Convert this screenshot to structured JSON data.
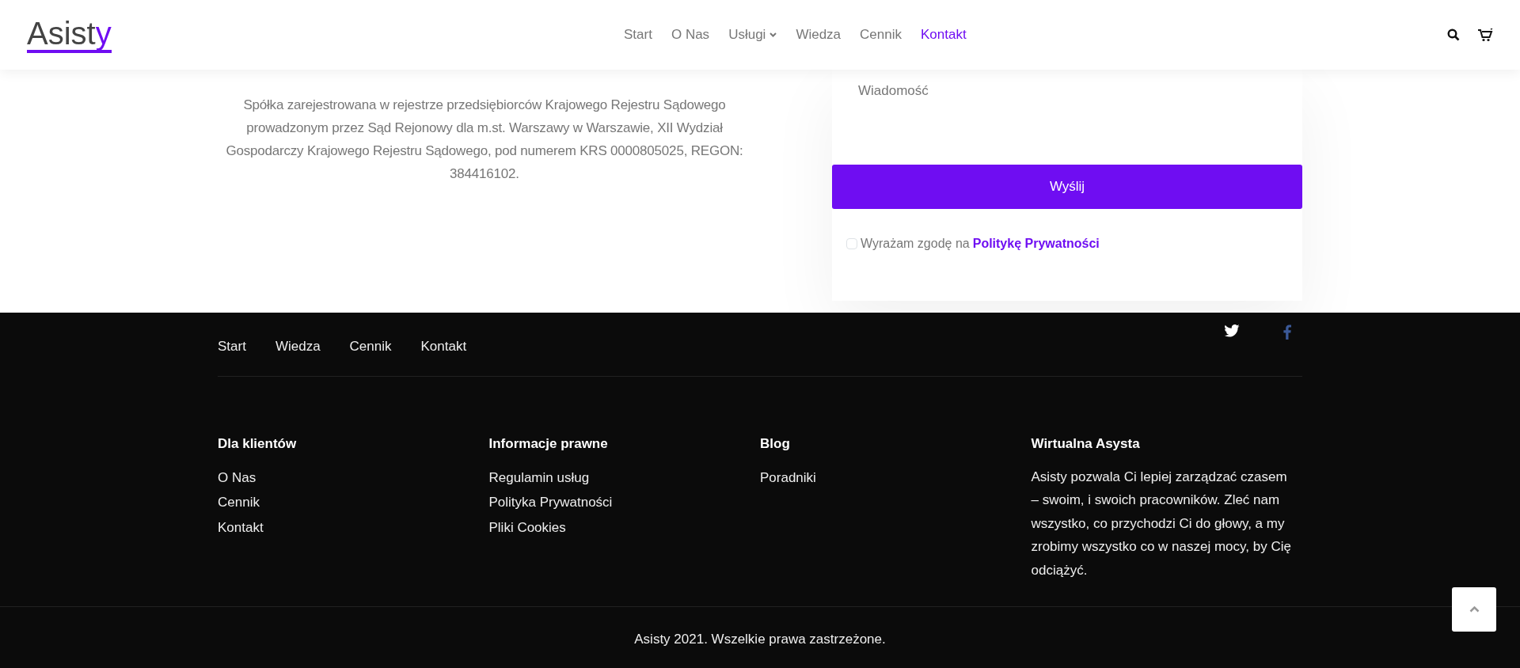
{
  "header": {
    "logo": {
      "text": "Asist",
      "accent": "y"
    },
    "nav": [
      {
        "label": "Start",
        "selected": false,
        "dropdown": false
      },
      {
        "label": "O Nas",
        "selected": false,
        "dropdown": false
      },
      {
        "label": "Usługi",
        "selected": false,
        "dropdown": true
      },
      {
        "label": "Wiedza",
        "selected": false,
        "dropdown": false
      },
      {
        "label": "Cennik",
        "selected": false,
        "dropdown": false
      },
      {
        "label": "Kontakt",
        "selected": true,
        "dropdown": false
      }
    ]
  },
  "company_info": "Spółka zarejestrowana w rejestrze przedsiębiorców Krajowego Rejestru Sądowego prowadzonym przez Sąd Rejonowy dla m.st. Warszawy w Warszawie, XII Wydział Gospodarczy Krajowego Rejestru Sądowego, pod numerem KRS 0000805025, REGON: 384416102.",
  "form": {
    "message": {
      "placeholder": "Wiadomość"
    },
    "submit": "Wyślij",
    "consent": {
      "text": "Wyrażam zgodę na",
      "link": "Politykę Prywatności",
      "checked": false
    }
  },
  "footer": {
    "nav": [
      "Start",
      "Wiedza",
      "Cennik",
      "Kontakt"
    ],
    "columns": [
      {
        "title": "Dla klientów",
        "links": [
          "O Nas",
          "Cennik",
          "Kontakt"
        ]
      },
      {
        "title": "Informacje prawne",
        "links": [
          "Regulamin usług",
          "Polityka Prywatności",
          "Pliki Cookies"
        ]
      },
      {
        "title": "Blog",
        "links": [
          "Poradniki"
        ]
      },
      {
        "title": "Wirtualna Asysta",
        "text": "Asisty pozwala Ci lepiej zarządzać czasem – swoim, i swoich pracowników. Zleć nam wszystko, co przychodzi Ci do głowy, a my zrobimy wszystko co w naszej mocy, by Cię odciążyć."
      }
    ],
    "copyright": "Asisty 2021. Wszelkie prawa zastrzeżone."
  }
}
